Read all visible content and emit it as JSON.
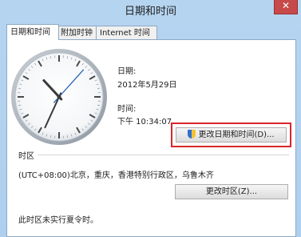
{
  "window": {
    "title": "日期和时间",
    "close": "✕"
  },
  "tabs": [
    {
      "label": "日期和时间"
    },
    {
      "label": "附加时钟"
    },
    {
      "label": "Internet 时间"
    }
  ],
  "date": {
    "label": "日期:",
    "value": "2012年5月29日"
  },
  "time": {
    "label": "时间:",
    "value": "下午 10:34:07"
  },
  "change_datetime_button": "更改日期和时间(D)...",
  "timezone": {
    "section_label": "时区",
    "value": "(UTC+08:00)北京，重庆，香港特别行政区，乌鲁木齐",
    "change_button": "更改时区(Z)..."
  },
  "dst_note": "此时区未实行夏令时。",
  "clock": {
    "hour": 10,
    "minute": 34,
    "second": 7
  },
  "colors": {
    "highlight": "#d9262b",
    "second_hand": "#1c5db5"
  }
}
